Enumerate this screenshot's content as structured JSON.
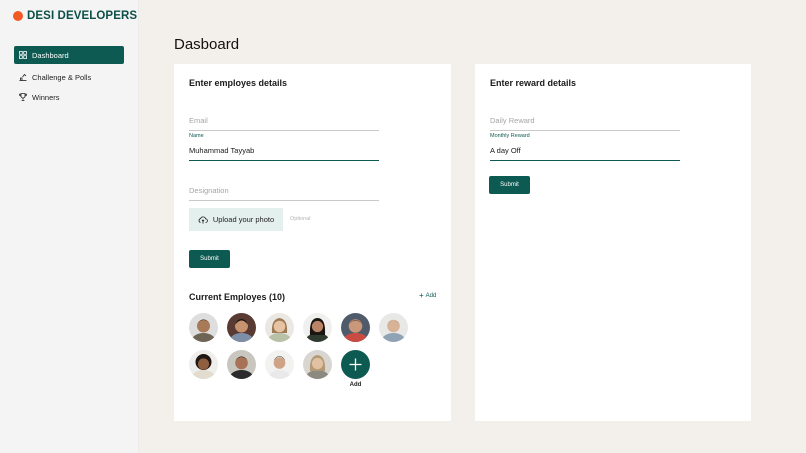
{
  "brand": {
    "name": "DESI DEVELOPERS",
    "dot_color": "#f15a24"
  },
  "sidebar": {
    "items": [
      {
        "label": "Dashboard",
        "icon": "grid-icon",
        "active": true
      },
      {
        "label": "Challenge & Polls",
        "icon": "chart-icon",
        "active": false
      },
      {
        "label": "Winners",
        "icon": "trophy-icon",
        "active": false
      }
    ]
  },
  "page": {
    "title": "Dasboard"
  },
  "employee_form": {
    "title": "Enter employes details",
    "email": {
      "label": "",
      "placeholder": "Email",
      "value": ""
    },
    "name": {
      "label": "Name",
      "placeholder": "Name",
      "value": "Muhammad Tayyab"
    },
    "designation": {
      "label": "",
      "placeholder": "Designation",
      "value": ""
    },
    "upload_label": "Upload your photo",
    "upload_note": "Optional",
    "submit_label": "Submit"
  },
  "employees": {
    "title": "Current Employes (10)",
    "add_link": "Add",
    "add_button_label": "Add",
    "avatar_count": 10
  },
  "reward_form": {
    "title": "Enter reward details",
    "daily": {
      "label": "",
      "placeholder": "Daily Reward",
      "value": ""
    },
    "monthly": {
      "label": "Monthly Reward",
      "placeholder": "Monthly Reward",
      "value": "A day Off"
    },
    "submit_label": "Submit"
  },
  "colors": {
    "primary": "#0d5a52",
    "accent": "#f15a24",
    "upload_bg": "#e4f0ee"
  }
}
